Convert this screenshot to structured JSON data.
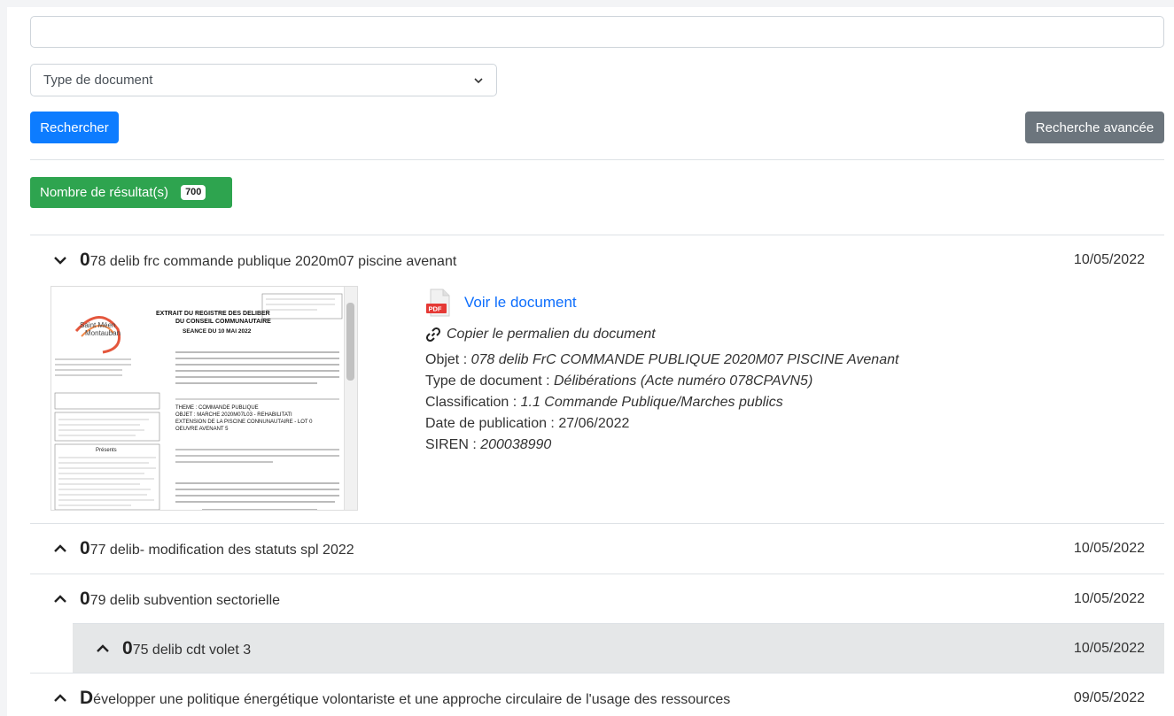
{
  "search": {
    "placeholder": "",
    "value": ""
  },
  "filter": {
    "selected": "Type de document"
  },
  "buttons": {
    "search": "Rechercher",
    "advanced": "Recherche avancée"
  },
  "results_summary": {
    "label": "Nombre de résultat(s)",
    "count": "700"
  },
  "expanded_result": {
    "initial": "0",
    "title_rest": "78 delib frc commande publique 2020m07 piscine avenant",
    "date": "10/05/2022",
    "view_document": "Voir le document",
    "permalink": "Copier le permalien du document",
    "objet_label": "Objet : ",
    "objet_value": "078 delib FrC COMMANDE PUBLIQUE 2020M07 PISCINE Avenant",
    "type_label": "Type de document : ",
    "type_value": "Délibérations (Acte numéro 078CPAVN5)",
    "classification_label": "Classification : ",
    "classification_value": "1.1 Commande Publique/Marches publics",
    "date_pub_label": "Date de publication : ",
    "date_pub_value": "27/06/2022",
    "siren_label": "SIREN : ",
    "siren_value": "200038990",
    "preview": {
      "org_line1": "Saint Méen",
      "org_line2": "Montauban",
      "heading1": "EXTRAIT DU REGISTRE DES DELIBER",
      "heading2": "DU CONSEIL COMMUNAUTAIRE",
      "seance": "SEANCE DU 10 MAI 2022",
      "theme": "THEME : COMMANDE PUBLIQUE",
      "objet": "OBJET : MARCHE 2020M07L03 - REHABILITATI",
      "objet2": "EXTENSION DE LA PISCINE CONNUNAUTAIRE - LOT 0",
      "objet3": "OEUVRE AVENANT 5",
      "presents": "Présents"
    }
  },
  "collapsed_results": [
    {
      "initial": "0",
      "title_rest": "77 delib- modification des statuts spl 2022",
      "date": "10/05/2022"
    },
    {
      "initial": "0",
      "title_rest": "79 delib subvention sectorielle",
      "date": "10/05/2022"
    },
    {
      "initial": "0",
      "title_rest": "75 delib cdt volet 3",
      "date": "10/05/2022"
    },
    {
      "initial": "D",
      "title_rest": "évelopper une politique énergétique volontariste et une approche circulaire de l'usage des ressources",
      "date": "09/05/2022"
    }
  ]
}
